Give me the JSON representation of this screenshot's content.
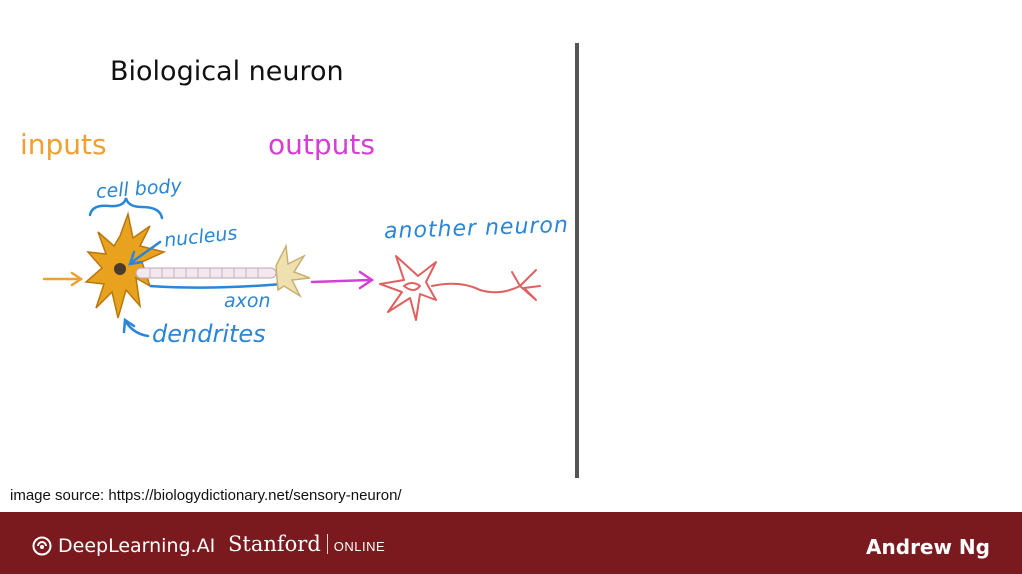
{
  "slide": {
    "title": "Biological neuron",
    "inputs_label": "inputs",
    "outputs_label": "outputs",
    "annotations": {
      "cell_body": "cell body",
      "nucleus": "nucleus",
      "axon": "axon",
      "dendrites": "dendrites",
      "another_neuron": "another neuron"
    },
    "image_credit": "image source: https://biologydictionary.net/sensory-neuron/"
  },
  "colors": {
    "inputs": "#f0a030",
    "outputs": "#d63fd6",
    "annotation": "#2a86d6",
    "neuron_body": "#e8a21e",
    "another_neuron": "#e06060",
    "footer_bg": "#7b1a1e"
  },
  "footer": {
    "brand": "DeepLearning.AI",
    "brand_icon": "deeplearning-logo-icon",
    "partner": "Stanford",
    "partner_suffix": "ONLINE",
    "author": "Andrew Ng"
  }
}
